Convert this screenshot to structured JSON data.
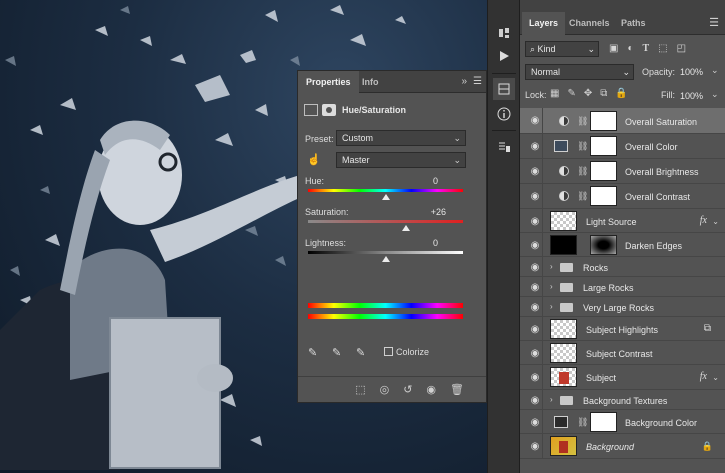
{
  "properties": {
    "tabs": [
      "Properties",
      "Info"
    ],
    "title": "Hue/Saturation",
    "preset_label": "Preset:",
    "preset_value": "Custom",
    "range_value": "Master",
    "hue_label": "Hue:",
    "hue_value": "0",
    "hue_level": 0.5,
    "saturation_label": "Saturation:",
    "saturation_value": "+26",
    "saturation_level": 0.63,
    "lightness_label": "Lightness:",
    "lightness_value": "0",
    "lightness_level": 0.5,
    "colorize_label": "Colorize",
    "expand_glyph": "»"
  },
  "layers_panel": {
    "tabs": [
      "Layers",
      "Channels",
      "Paths"
    ],
    "filter_kind": "Kind",
    "blend_mode": "Normal",
    "opacity_label": "Opacity:",
    "opacity_value": "100%",
    "lock_label": "Lock:",
    "fill_label": "Fill:",
    "fill_value": "100%",
    "layers": [
      {
        "name": "Overall Saturation",
        "kind": "hue-sat",
        "selected": true
      },
      {
        "name": "Overall Color",
        "kind": "color-fill",
        "swatch": "#3d4b5c"
      },
      {
        "name": "Overall Brightness",
        "kind": "levels"
      },
      {
        "name": "Overall Contrast",
        "kind": "levels"
      },
      {
        "name": "Light Source",
        "kind": "pixel-fx",
        "fx": "fx"
      },
      {
        "name": "Darken Edges",
        "kind": "pixel-mask"
      },
      {
        "name": "Rocks",
        "kind": "group"
      },
      {
        "name": "Large Rocks",
        "kind": "group"
      },
      {
        "name": "Very Large Rocks",
        "kind": "group"
      },
      {
        "name": "Subject Highlights",
        "kind": "pixel-link"
      },
      {
        "name": "Subject Contrast",
        "kind": "pixel"
      },
      {
        "name": "Subject",
        "kind": "subject-fx",
        "fx": "fx"
      },
      {
        "name": "Background Textures",
        "kind": "group"
      },
      {
        "name": "Background Color",
        "kind": "color-fill",
        "swatch": "#2b2b2b"
      },
      {
        "name": "Background",
        "kind": "background"
      }
    ]
  },
  "colors": {
    "panel": "#535353",
    "panel_dark": "#424242",
    "selected_row": "#6e6e6e",
    "canvas_blue": "#1c2d42"
  }
}
